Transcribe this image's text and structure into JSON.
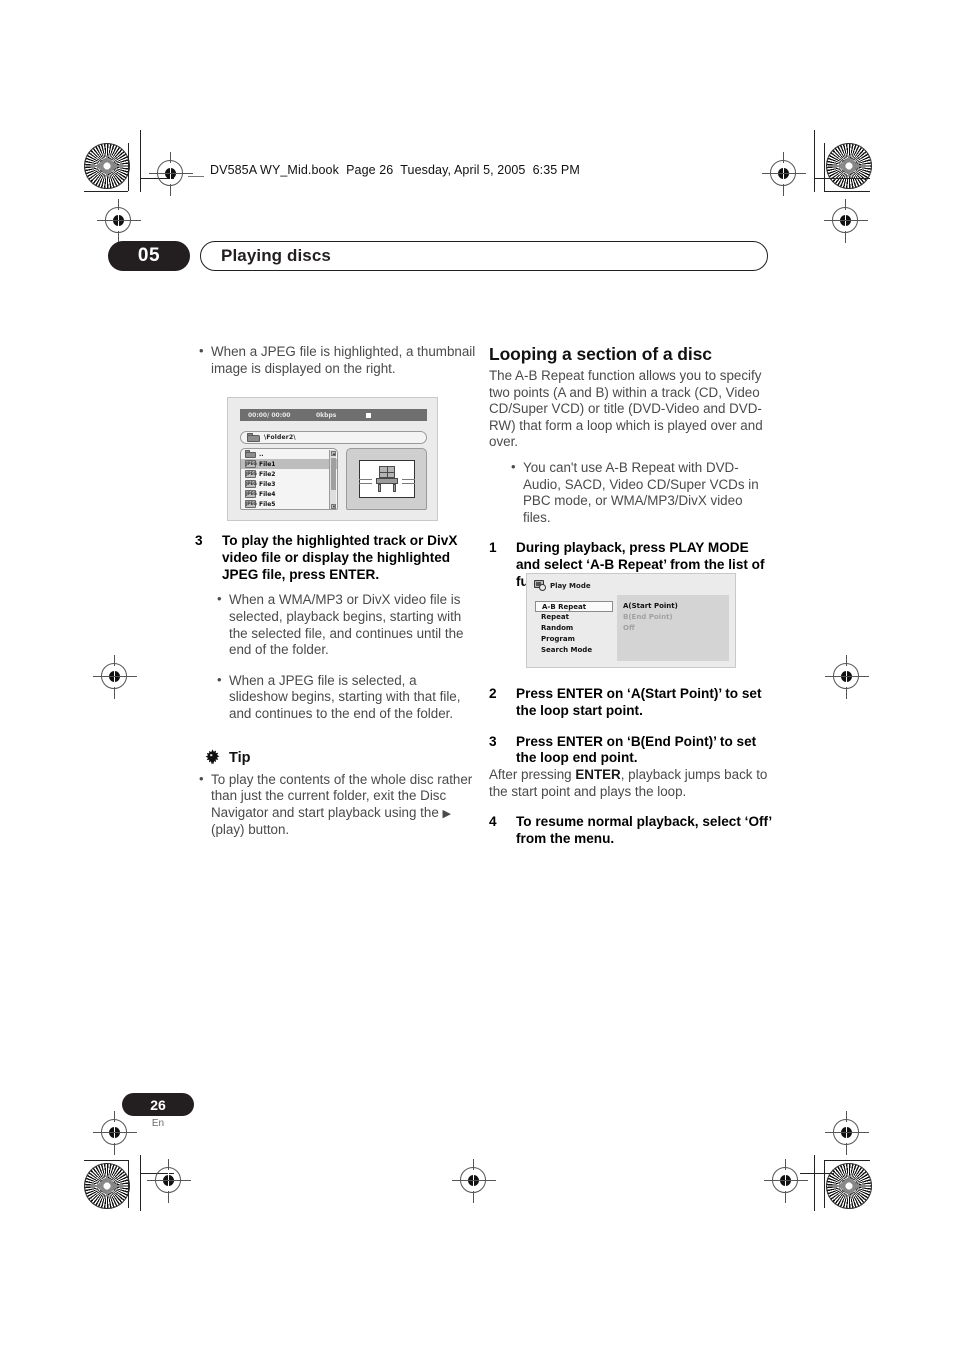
{
  "book_header": "DV585A WY_Mid.book  Page 26  Tuesday, April 5, 2005  6:35 PM",
  "chapter": {
    "number": "05",
    "title": "Playing discs"
  },
  "footer": {
    "page": "26",
    "language": "En"
  },
  "left_column": {
    "intro_bullet": "When a JPEG file is highlighted, a thumbnail image is displayed on the right.",
    "disc_navigator_screenshot": {
      "name": "disc-navigator",
      "status_time": "00:00/ 00:00",
      "status_bitrate": "0kbps",
      "status_icon": "stop-icon",
      "path": "\\Folder2\\",
      "path_icon": "folder-icon",
      "files": [
        {
          "icon": "folder-up-icon",
          "label": ".."
        },
        {
          "icon": "jpeg-file-icon",
          "label": "File1"
        },
        {
          "icon": "jpeg-file-icon",
          "label": "File2"
        },
        {
          "icon": "jpeg-file-icon",
          "label": "File3"
        },
        {
          "icon": "jpeg-file-icon",
          "label": "File4"
        },
        {
          "icon": "jpeg-file-icon",
          "label": "File5"
        }
      ],
      "selected_file": "File1",
      "file_icon_text": "JPEG",
      "preview_alt": "chair-thumbnail"
    },
    "step3": {
      "number": "3",
      "text": "To play the highlighted track or DivX video file or display the highlighted JPEG file, press ENTER."
    },
    "step3_bullets": [
      "When a WMA/MP3 or DivX video file is selected, playback begins, starting with the selected file, and continues until the end of the folder.",
      "When a JPEG file is selected, a slideshow begins, starting with that file, and continues to the end of the folder."
    ],
    "tip": {
      "icon": "tip-bulb-icon",
      "label": "Tip",
      "bullet_pre": "To play the contents of the whole disc rather than just the current folder, exit the Disc Navigator and start playback using the ",
      "play_glyph": "▶",
      "bullet_post": " (play) button."
    }
  },
  "right_column": {
    "section_heading": "Looping a section of a disc",
    "intro": "The A-B Repeat function allows you to specify two points (A and B) within a track (CD, Video CD/Super VCD) or title (DVD-Video and DVD-RW) that form a loop which is played over and over.",
    "intro_bullet": "You can't use A-B Repeat with DVD-Audio, SACD, Video CD/Super VCDs in PBC mode, or WMA/MP3/DivX video files.",
    "step1": {
      "number": "1",
      "text": "During playback, press PLAY MODE and select ‘A-B Repeat’ from the list of functions on the left."
    },
    "play_mode_screenshot": {
      "name": "play-mode-dialog",
      "title": "Play Mode",
      "title_icon": "play-mode-icon",
      "menu_items": [
        "A-B Repeat",
        "Repeat",
        "Random",
        "Program",
        "Search Mode"
      ],
      "selected_menu_item": "A-B Repeat",
      "options": [
        {
          "label": "A(Start Point)",
          "state": "enabled"
        },
        {
          "label": "B(End Point)",
          "state": "disabled"
        },
        {
          "label": "Off",
          "state": "disabled"
        }
      ]
    },
    "step2": {
      "number": "2",
      "text": "Press ENTER on ‘A(Start Point)’ to set the loop start point."
    },
    "step3": {
      "number": "3",
      "text": "Press ENTER on ‘B(End Point)’ to set the loop end point."
    },
    "step3_note_pre": "After pressing ",
    "step3_note_bold": "ENTER",
    "step3_note_post": ", playback jumps back to the start point and plays the loop.",
    "step4": {
      "number": "4",
      "text": "To resume normal playback, select ‘Off’ from the menu."
    }
  },
  "colors": {
    "ink": "#231f20",
    "body_text": "#4a4a4a",
    "screenshot_bg": "#ebebeb",
    "status_bar": "#6f6f6f",
    "panel": "#d4d4d4",
    "selection": "#bdbdbd"
  }
}
